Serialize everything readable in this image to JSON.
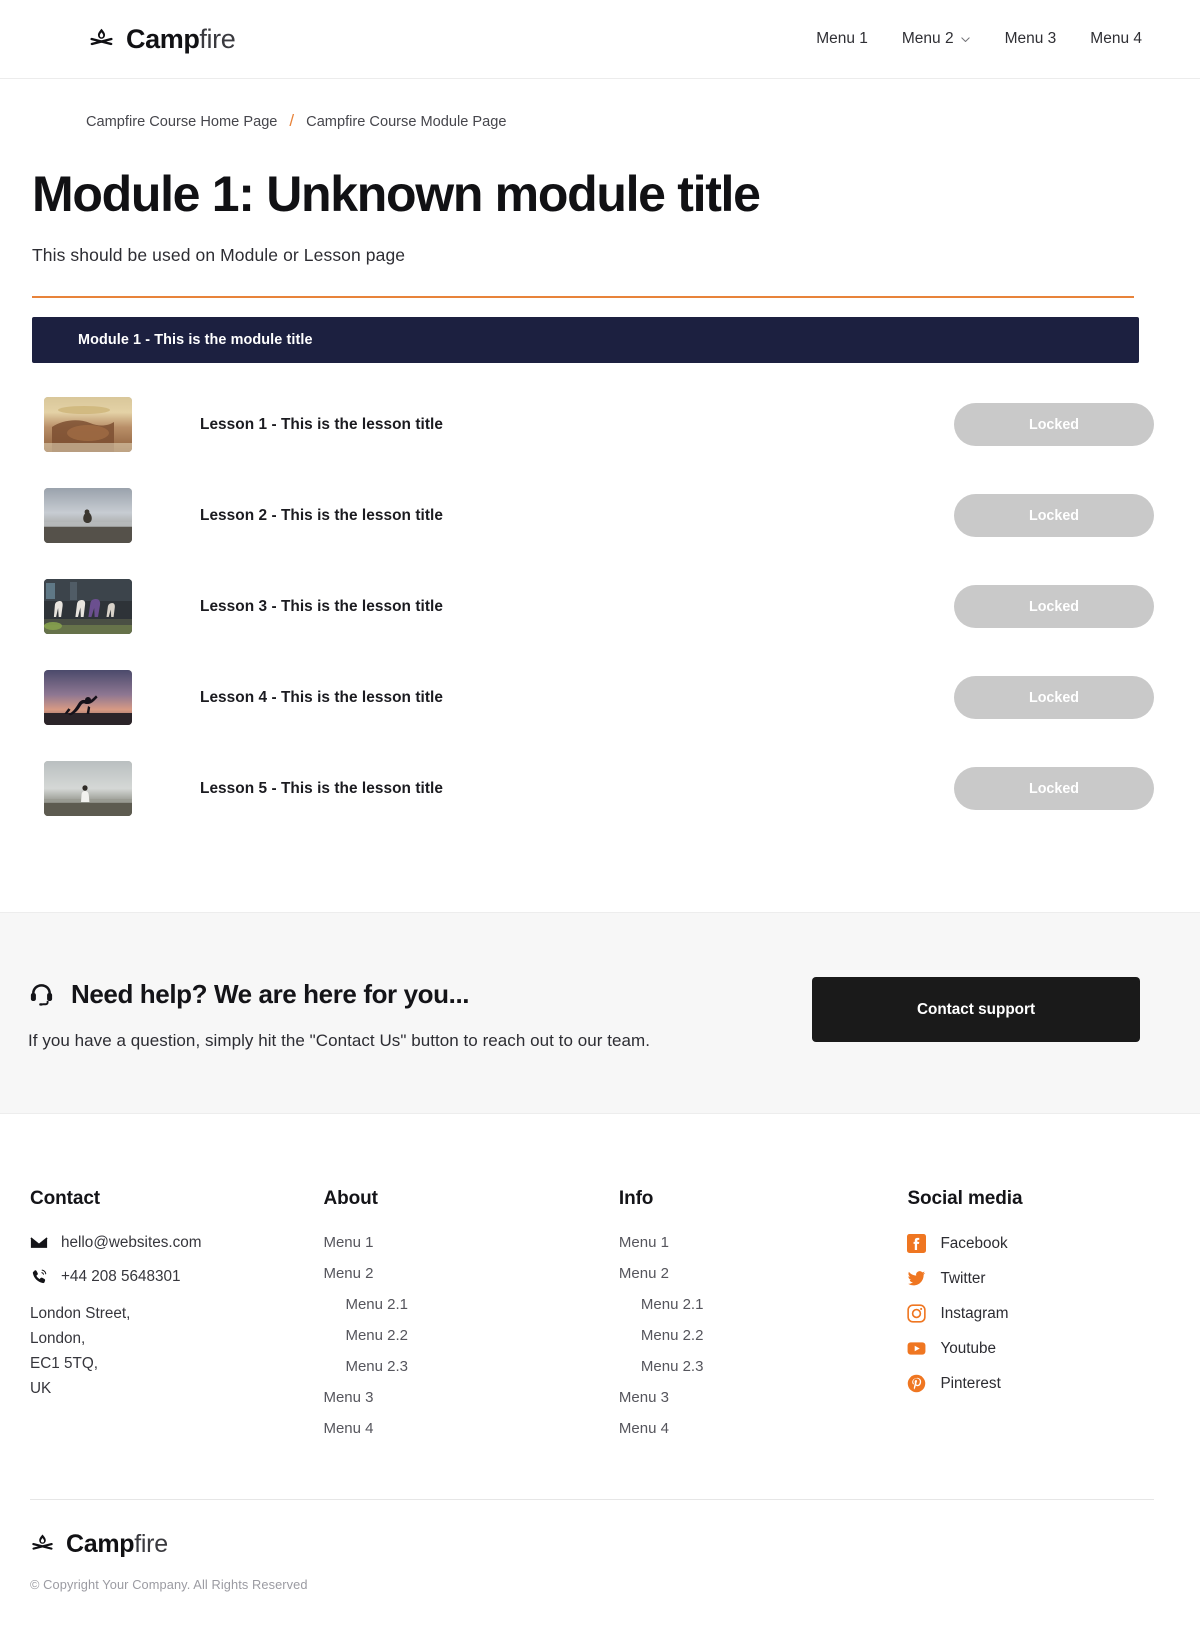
{
  "header": {
    "brand": {
      "bold": "Camp",
      "light": "fire",
      "icon": "campfire-icon"
    },
    "nav": [
      {
        "label": "Menu 1",
        "has_chevron": false
      },
      {
        "label": "Menu 2",
        "has_chevron": true
      },
      {
        "label": "Menu 3",
        "has_chevron": false
      },
      {
        "label": "Menu 4",
        "has_chevron": false
      }
    ]
  },
  "breadcrumb": {
    "home": "Campfire Course Home Page",
    "separator": "/",
    "current": "Campfire Course Module Page"
  },
  "page": {
    "title": "Module 1: Unknown module title",
    "subtitle": "This should be used on Module or Lesson page",
    "accent_color": "#e8833a"
  },
  "module": {
    "bar_title": "Module 1 - This is the module title",
    "bar_color": "#1c2040",
    "lessons": [
      {
        "title": "Lesson 1 - This is the lesson title",
        "status": "Locked",
        "thumb": "hands-on-beach-sunset"
      },
      {
        "title": "Lesson 2 - This is the lesson title",
        "status": "Locked",
        "thumb": "person-sitting-shore-dusk"
      },
      {
        "title": "Lesson 3 - This is the lesson title",
        "status": "Locked",
        "thumb": "yoga-class-studio"
      },
      {
        "title": "Lesson 4 - This is the lesson title",
        "status": "Locked",
        "thumb": "yoga-pose-sunset"
      },
      {
        "title": "Lesson 5 - This is the lesson title",
        "status": "Locked",
        "thumb": "person-meditating-mist"
      }
    ]
  },
  "help": {
    "icon": "headset-icon",
    "heading": "Need help? We are here for you...",
    "subtext": "If you have a question, simply hit the \"Contact Us\" button to reach out to our team.",
    "button_label": "Contact support"
  },
  "footer": {
    "contact": {
      "heading": "Contact",
      "email": "hello@websites.com",
      "phone": "+44 208 5648301",
      "address": "London Street,\nLondon,\nEC1 5TQ,\nUK"
    },
    "about": {
      "heading": "About",
      "items": [
        {
          "label": "Menu 1",
          "sub": false
        },
        {
          "label": "Menu 2",
          "sub": false
        },
        {
          "label": "Menu 2.1",
          "sub": true
        },
        {
          "label": "Menu 2.2",
          "sub": true
        },
        {
          "label": "Menu 2.3",
          "sub": true
        },
        {
          "label": "Menu 3",
          "sub": false
        },
        {
          "label": "Menu 4",
          "sub": false
        }
      ]
    },
    "info": {
      "heading": "Info",
      "items": [
        {
          "label": "Menu 1",
          "sub": false
        },
        {
          "label": "Menu 2",
          "sub": false
        },
        {
          "label": "Menu 2.1",
          "sub": true
        },
        {
          "label": "Menu 2.2",
          "sub": true
        },
        {
          "label": "Menu 2.3",
          "sub": true
        },
        {
          "label": "Menu 3",
          "sub": false
        },
        {
          "label": "Menu 4",
          "sub": false
        }
      ]
    },
    "social": {
      "heading": "Social media",
      "icon_color": "#ef7621",
      "items": [
        {
          "label": "Facebook",
          "icon": "facebook-icon"
        },
        {
          "label": "Twitter",
          "icon": "twitter-icon"
        },
        {
          "label": "Instagram",
          "icon": "instagram-icon"
        },
        {
          "label": "Youtube",
          "icon": "youtube-icon"
        },
        {
          "label": "Pinterest",
          "icon": "pinterest-icon"
        }
      ]
    },
    "bottom": {
      "brand": {
        "bold": "Camp",
        "light": "fire"
      },
      "copyright": "© Copyright Your Company.  All Rights Reserved"
    }
  }
}
